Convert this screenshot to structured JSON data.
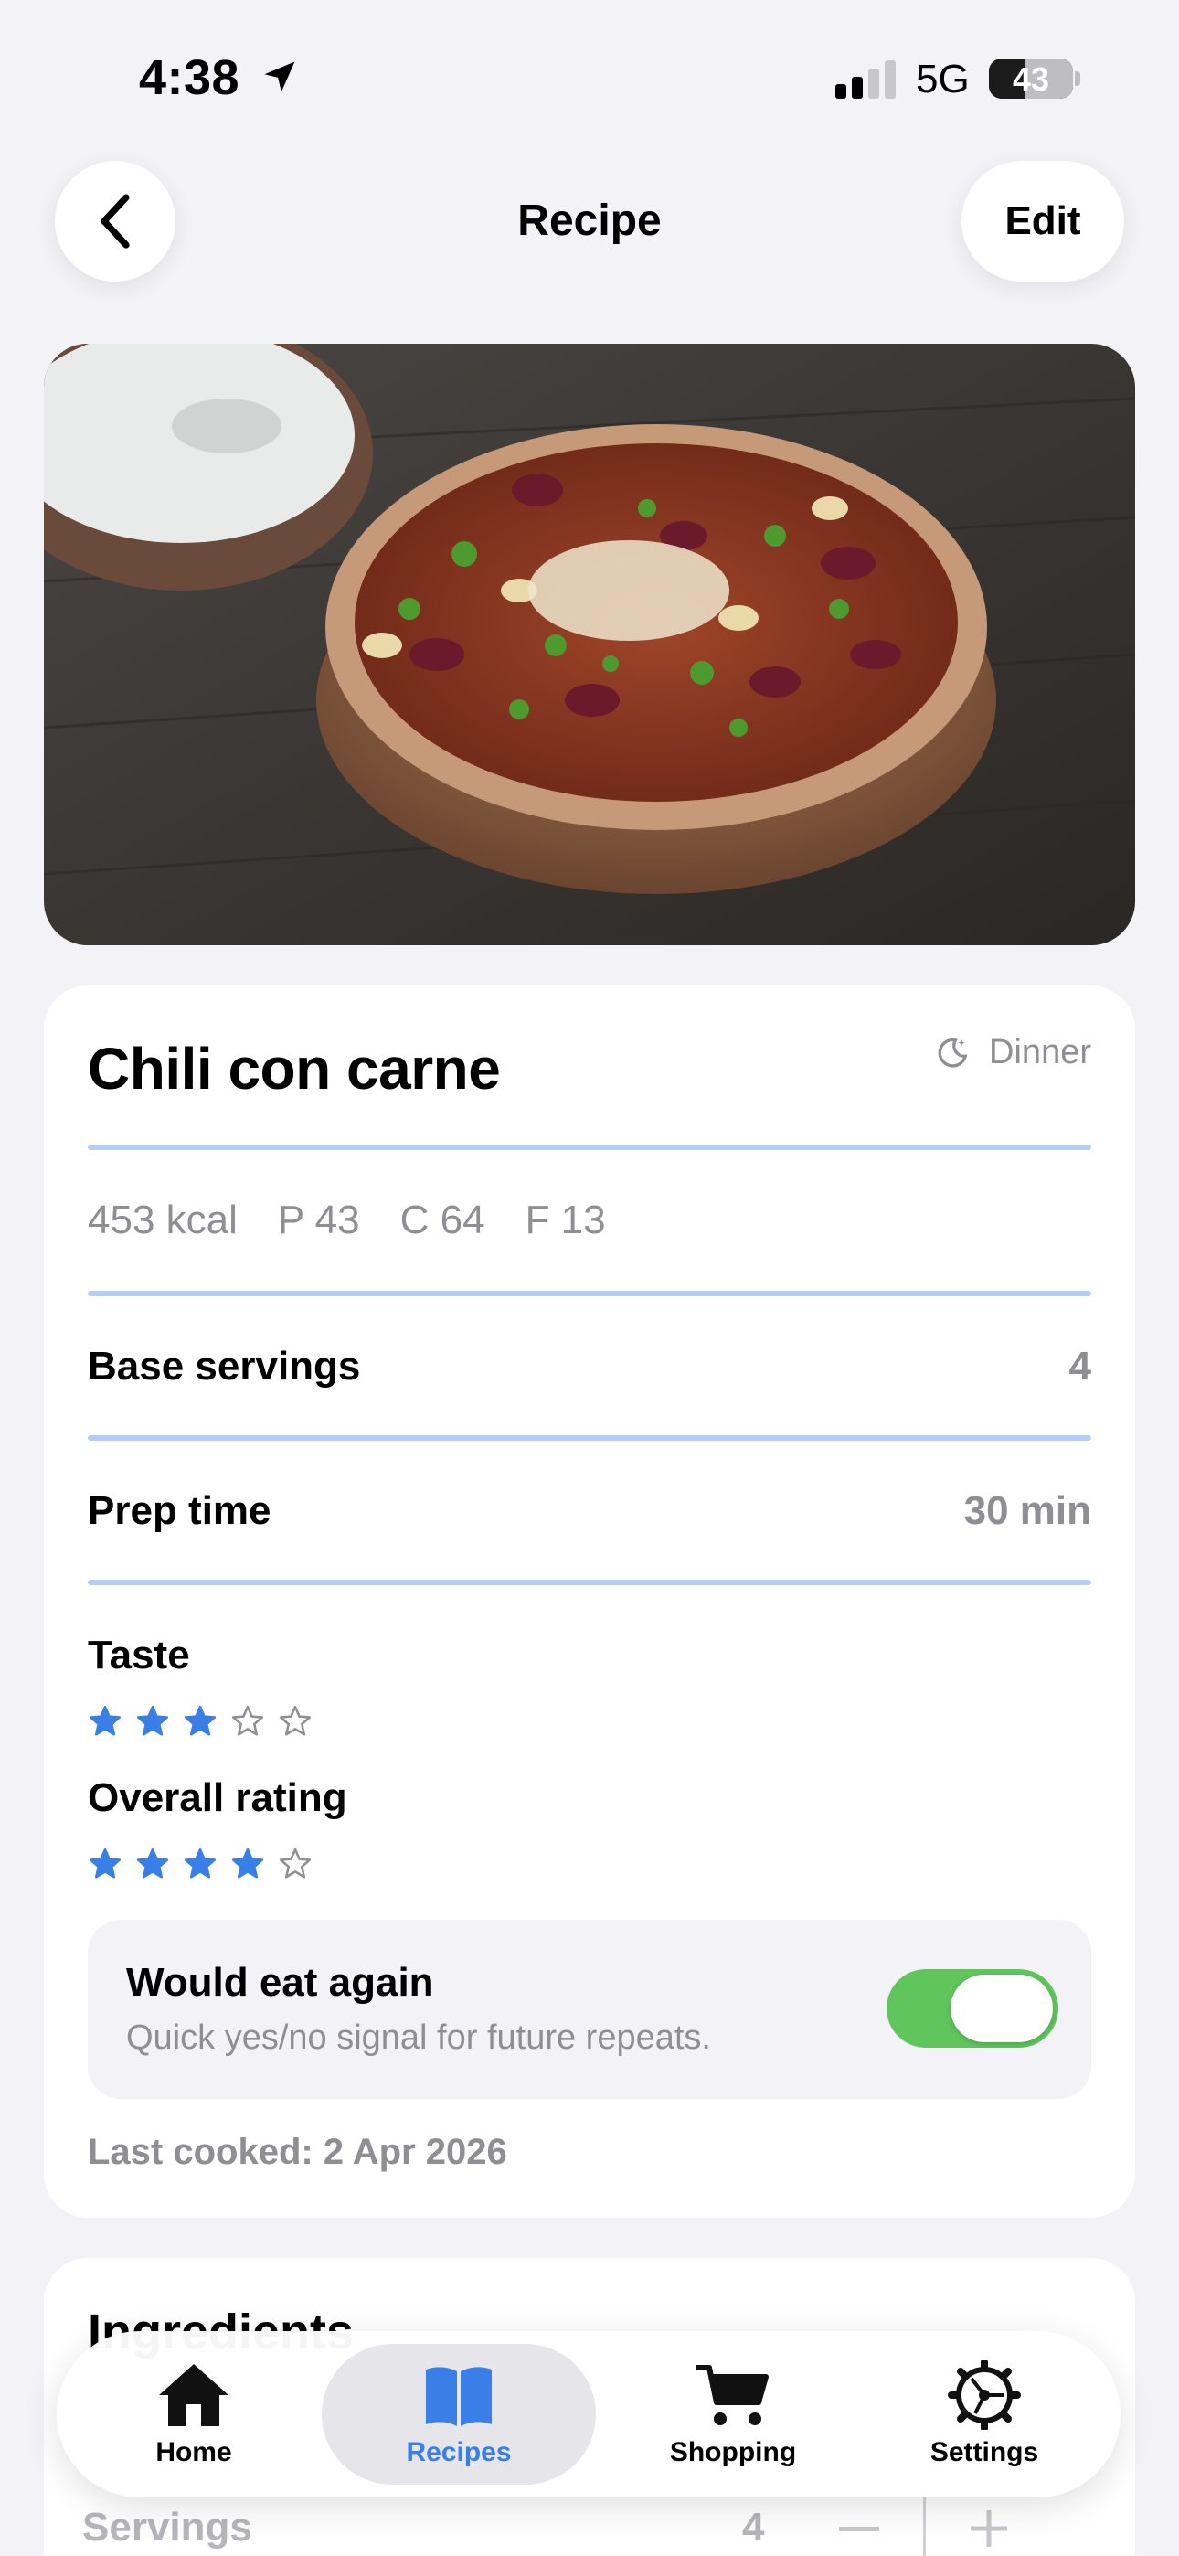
{
  "status_bar": {
    "time": "4:38",
    "network": "5G",
    "battery_level": "43",
    "battery_fraction": 0.43
  },
  "nav": {
    "title": "Recipe",
    "edit_label": "Edit"
  },
  "recipe": {
    "name": "Chili con carne",
    "meal_type": "Dinner",
    "macros": {
      "kcal": "453 kcal",
      "protein": "P 43",
      "carbs": "C 64",
      "fat": "F 13"
    },
    "base_servings_label": "Base servings",
    "base_servings_value": "4",
    "prep_time_label": "Prep time",
    "prep_time_value": "30 min",
    "taste_label": "Taste",
    "taste_rating": 3,
    "overall_label": "Overall rating",
    "overall_rating": 4,
    "max_rating": 5,
    "eat_again_title": "Would eat again",
    "eat_again_subtitle": "Quick yes/no signal for future repeats.",
    "eat_again_on": true,
    "last_cooked": "Last cooked: 2 Apr 2026"
  },
  "ingredients": {
    "title": "Ingredients",
    "servings_label": "Servings",
    "servings_value": "4"
  },
  "tabs": [
    {
      "label": "Home",
      "icon": "house-icon",
      "active": false
    },
    {
      "label": "Recipes",
      "icon": "book-icon",
      "active": true
    },
    {
      "label": "Shopping",
      "icon": "cart-icon",
      "active": false
    },
    {
      "label": "Settings",
      "icon": "gear-icon",
      "active": false
    }
  ],
  "colors": {
    "accent": "#3a7ee8",
    "toggle_on": "#60c55d",
    "separator": "#b3cef2",
    "background": "#f2f2f7"
  }
}
